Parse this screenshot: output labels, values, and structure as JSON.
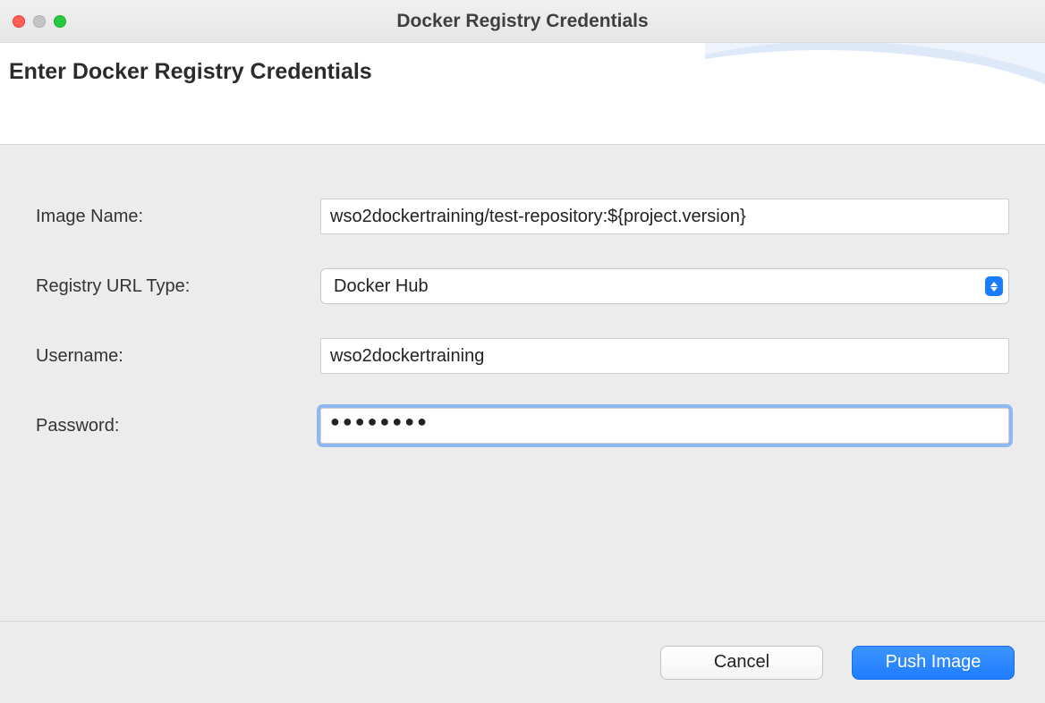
{
  "window": {
    "title": "Docker Registry Credentials"
  },
  "header": {
    "heading": "Enter Docker Registry Credentials"
  },
  "form": {
    "imageName": {
      "label": "Image Name:",
      "value": "wso2dockertraining/test-repository:${project.version}"
    },
    "registryType": {
      "label": "Registry URL Type:",
      "selected": "Docker Hub"
    },
    "username": {
      "label": "Username:",
      "value": "wso2dockertraining"
    },
    "password": {
      "label": "Password:",
      "masked": "●●●●●●●●"
    }
  },
  "buttons": {
    "cancel": "Cancel",
    "push": "Push Image"
  }
}
